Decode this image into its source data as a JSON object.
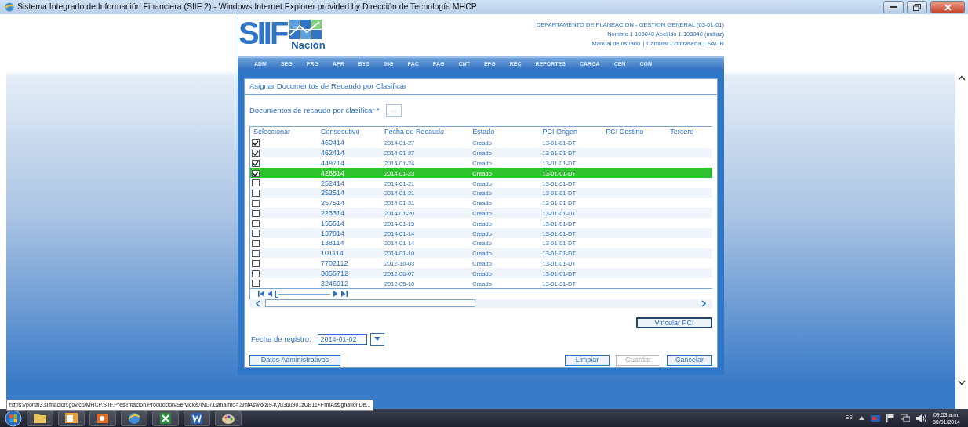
{
  "window": {
    "title": "Sistema Integrado de Información Financiera (SIIF 2) - Windows Internet Explorer provided by Dirección de Tecnología MHCP"
  },
  "header": {
    "logo_text": "SIIF",
    "logo_sub": "Nación",
    "org": "DEPARTAMENTO DE PLANEACION - GESTION GENERAL (03-01-01)",
    "user": "Nombre 1 108040 Apellido 1 108040 (mdiaz)",
    "links": [
      "Manual de usuario",
      "Cambiar Contraseña",
      "SALIR"
    ],
    "link_separator": "|"
  },
  "menu": [
    "ADM",
    "SEG",
    "PRG",
    "APR",
    "BYS",
    "ING",
    "PAC",
    "PAG",
    "CNT",
    "EPG",
    "REC",
    "REPORTES",
    "CARGA",
    "CEN",
    "CON"
  ],
  "form": {
    "title": "Asignar Documentos de Recaudo por Clasificar",
    "doc_label": "Documentos de recaudo por clasificar *",
    "doc_button": "...",
    "table": {
      "columns": [
        "Seleccionar",
        "Consecutivo",
        "Fecha de Recaudo",
        "Estado",
        "PCI Origen",
        "PCI Destino",
        "Tercero"
      ],
      "rows": [
        {
          "checked": true,
          "selected": false,
          "consecutivo": "460414",
          "fecha": "2014-01-27",
          "estado": "Creado",
          "pci_origen": "13-01-01-DT"
        },
        {
          "checked": true,
          "selected": false,
          "consecutivo": "462414",
          "fecha": "2014-01-27",
          "estado": "Creado",
          "pci_origen": "13-01-01-DT"
        },
        {
          "checked": true,
          "selected": false,
          "consecutivo": "449714",
          "fecha": "2014-01-24",
          "estado": "Creado",
          "pci_origen": "13-01-01-DT"
        },
        {
          "checked": true,
          "selected": true,
          "consecutivo": "428814",
          "fecha": "2014-01-23",
          "estado": "Creado",
          "pci_origen": "13-01-01-DT"
        },
        {
          "checked": false,
          "selected": false,
          "consecutivo": "252414",
          "fecha": "2014-01-21",
          "estado": "Creado",
          "pci_origen": "13-01-01-DT"
        },
        {
          "checked": false,
          "selected": false,
          "consecutivo": "252514",
          "fecha": "2014-01-21",
          "estado": "Creado",
          "pci_origen": "13-01-01-DT"
        },
        {
          "checked": false,
          "selected": false,
          "consecutivo": "257514",
          "fecha": "2014-01-21",
          "estado": "Creado",
          "pci_origen": "13-01-01-DT"
        },
        {
          "checked": false,
          "selected": false,
          "consecutivo": "223314",
          "fecha": "2014-01-20",
          "estado": "Creado",
          "pci_origen": "13-01-01-DT"
        },
        {
          "checked": false,
          "selected": false,
          "consecutivo": "155614",
          "fecha": "2014-01-15",
          "estado": "Creado",
          "pci_origen": "13-01-01-DT"
        },
        {
          "checked": false,
          "selected": false,
          "consecutivo": "137814",
          "fecha": "2014-01-14",
          "estado": "Creado",
          "pci_origen": "13-01-01-DT"
        },
        {
          "checked": false,
          "selected": false,
          "consecutivo": "138114",
          "fecha": "2014-01-14",
          "estado": "Creado",
          "pci_origen": "13-01-01-DT"
        },
        {
          "checked": false,
          "selected": false,
          "consecutivo": "101114",
          "fecha": "2014-01-10",
          "estado": "Creado",
          "pci_origen": "13-01-01-DT"
        },
        {
          "checked": false,
          "selected": false,
          "consecutivo": "7702112",
          "fecha": "2012-10-03",
          "estado": "Creado",
          "pci_origen": "13-01-01-DT"
        },
        {
          "checked": false,
          "selected": false,
          "consecutivo": "3856712",
          "fecha": "2012-06-07",
          "estado": "Creado",
          "pci_origen": "13-01-01-DT"
        },
        {
          "checked": false,
          "selected": false,
          "consecutivo": "3246912",
          "fecha": "2012-05-10",
          "estado": "Creado",
          "pci_origen": "13-01-01-DT"
        }
      ],
      "pager": {
        "level": 0
      }
    },
    "link_button": "Vincular PCI",
    "date_label": "Fecha de registro:",
    "date_value": "2014-01-02",
    "buttons": [
      {
        "label": "Datos Administrativos",
        "disabled": false
      },
      {
        "label": "Limpiar",
        "disabled": false
      },
      {
        "label": "Guardar",
        "disabled": true
      },
      {
        "label": "Cancelar",
        "disabled": false
      }
    ]
  },
  "status_url": "https://portal3.siifnacion.gov.co/MHCP.SIIF.Presentacion.Produccion/Servicios/ING/,DanaInfo=.amiAswkkzi9-Kyu36u901zUB11+FrmAssignationDe...",
  "taskbar": {
    "language": "ES",
    "time": "09:53 a.m.",
    "date": "30/01/2014"
  }
}
